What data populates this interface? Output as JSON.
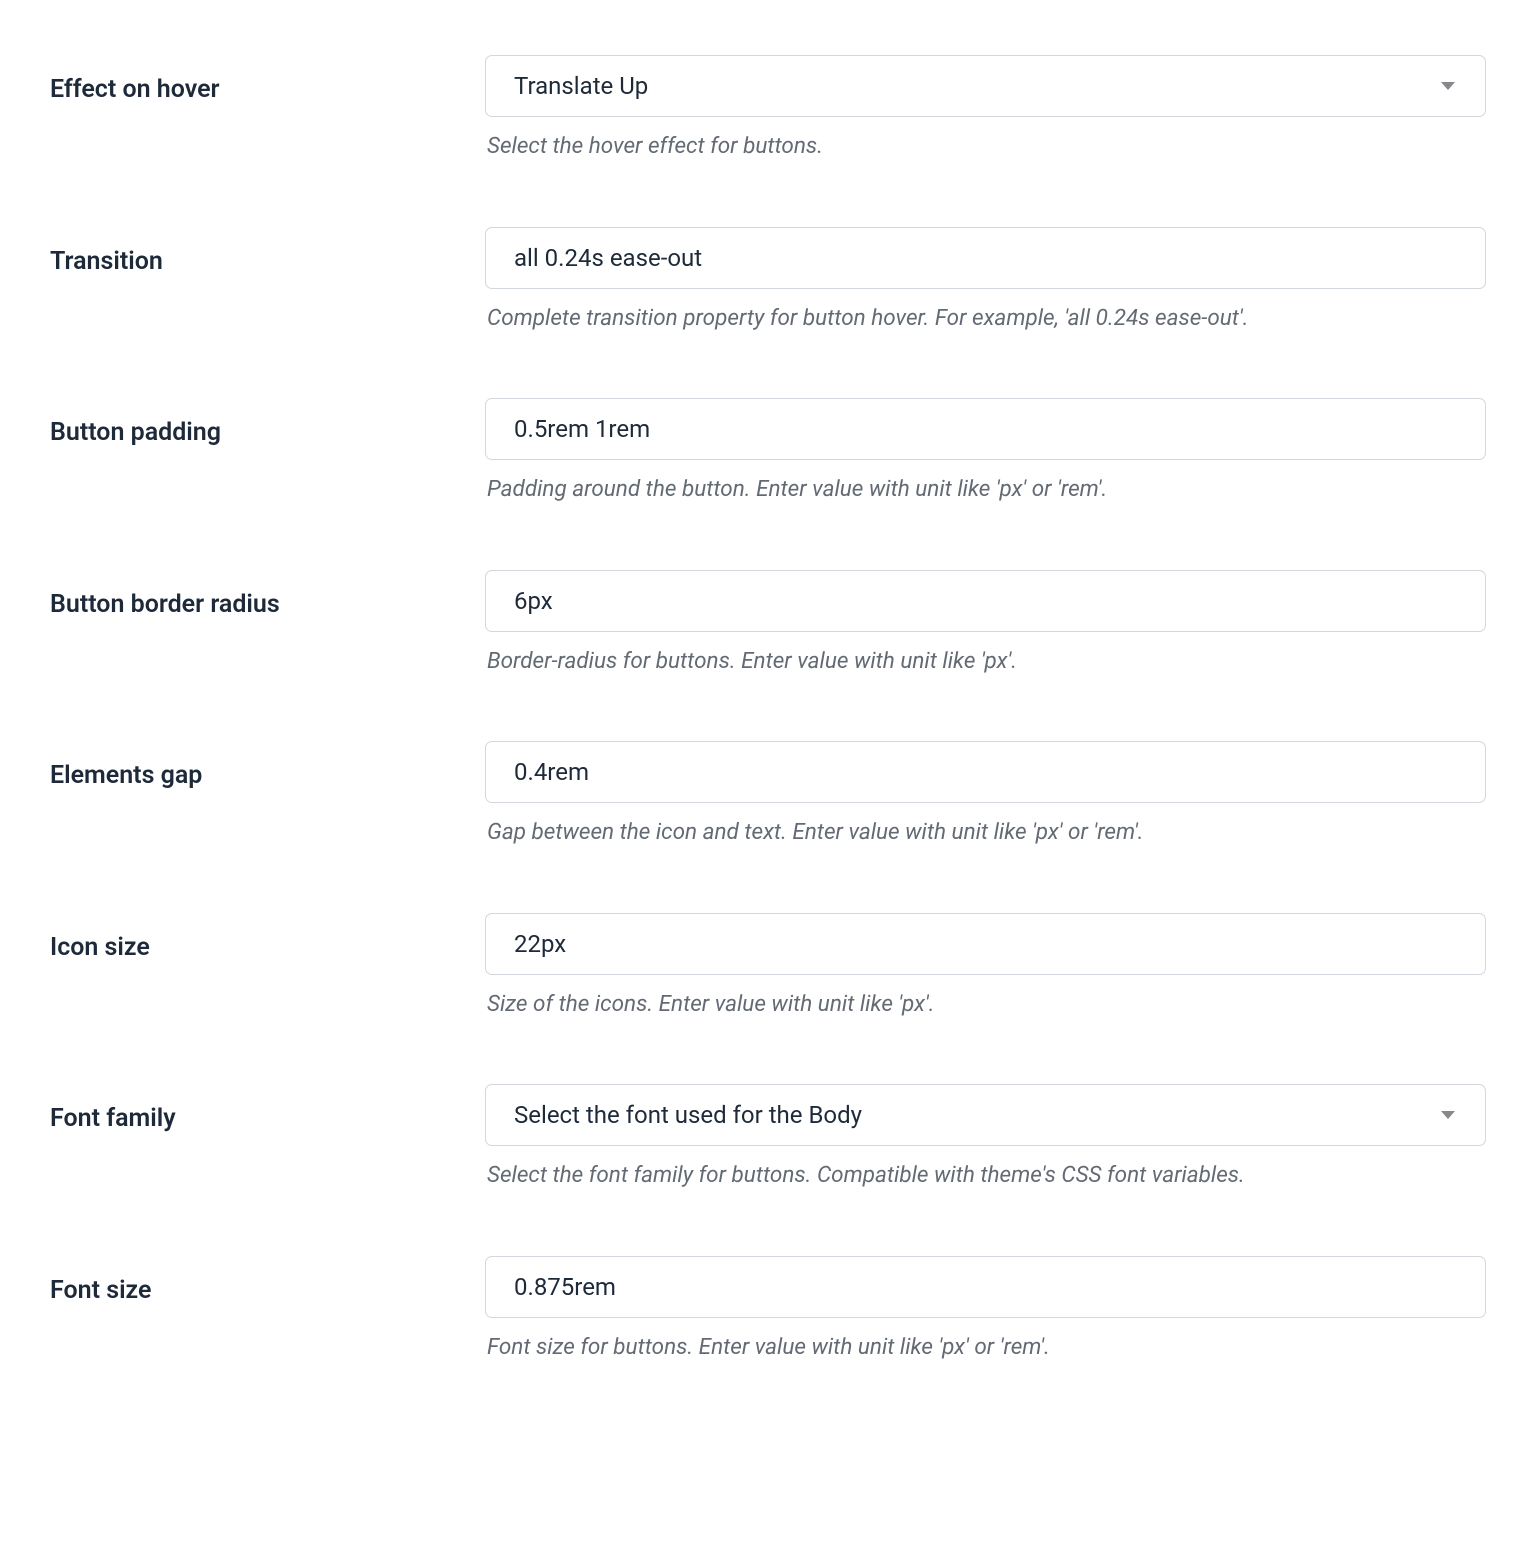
{
  "fields": {
    "effect_on_hover": {
      "label": "Effect on hover",
      "value": "Translate Up",
      "help": "Select the hover effect for buttons."
    },
    "transition": {
      "label": "Transition",
      "value": "all 0.24s ease-out",
      "help": "Complete transition property for button hover. For example, 'all 0.24s ease-out'."
    },
    "button_padding": {
      "label": "Button padding",
      "value": "0.5rem 1rem",
      "help": "Padding around the button. Enter value with unit like 'px' or 'rem'."
    },
    "button_border_radius": {
      "label": "Button border radius",
      "value": "6px",
      "help": "Border-radius for buttons. Enter value with unit like 'px'."
    },
    "elements_gap": {
      "label": "Elements gap",
      "value": "0.4rem",
      "help": "Gap between the icon and text. Enter value with unit like 'px' or 'rem'."
    },
    "icon_size": {
      "label": "Icon size",
      "value": "22px",
      "help": "Size of the icons. Enter value with unit like 'px'."
    },
    "font_family": {
      "label": "Font family",
      "value": "Select the font used for the Body",
      "help": "Select the font family for buttons. Compatible with theme's CSS font variables."
    },
    "font_size": {
      "label": "Font size",
      "value": "0.875rem",
      "help": "Font size for buttons. Enter value with unit like 'px' or 'rem'."
    }
  }
}
